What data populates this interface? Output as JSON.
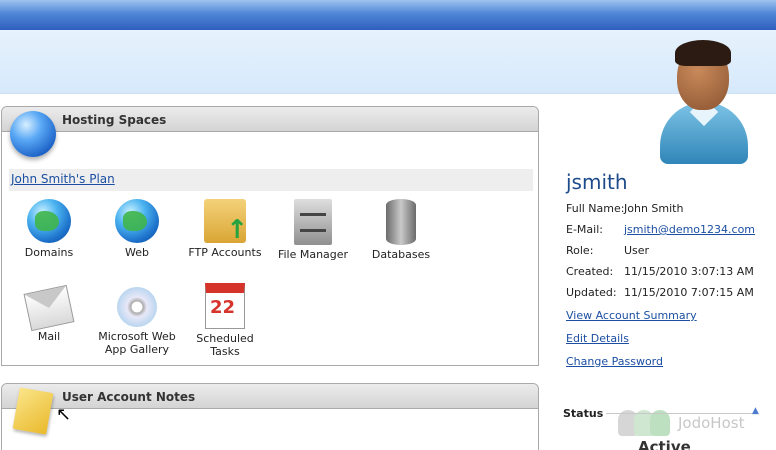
{
  "hosting": {
    "title": "Hosting Spaces",
    "plan_link": "John Smith's Plan",
    "tiles": [
      {
        "label": "Domains",
        "icon": "globe-domains-icon"
      },
      {
        "label": "Web",
        "icon": "globe-web-icon"
      },
      {
        "label": "FTP Accounts",
        "icon": "ftp-folder-icon"
      },
      {
        "label": "File Manager",
        "icon": "file-cabinet-icon"
      },
      {
        "label": "Databases",
        "icon": "database-icon"
      },
      {
        "label": "Mail",
        "icon": "mail-envelope-icon"
      },
      {
        "label": "Microsoft Web App Gallery",
        "icon": "cd-disc-icon"
      },
      {
        "label": "Scheduled Tasks",
        "icon": "calendar-clock-icon"
      }
    ]
  },
  "notes": {
    "title": "User Account Notes"
  },
  "user": {
    "username": "jsmith",
    "rows": [
      {
        "label": "Full Name:",
        "value": "John Smith"
      },
      {
        "label": "E-Mail:",
        "value": "jsmith@demo1234.com"
      },
      {
        "label": "Role:",
        "value": "User"
      },
      {
        "label": "Created:",
        "value": "11/15/2010 3:07:13 AM"
      },
      {
        "label": "Updated:",
        "value": "11/15/2010 7:07:15 AM"
      }
    ],
    "links": {
      "summary": "View Account Summary",
      "edit": "Edit Details",
      "password": "Change Password"
    }
  },
  "status": {
    "title": "Status",
    "value": "Active"
  },
  "watermark": {
    "text": "JodoHost"
  },
  "colors": {
    "link": "#1c4fa3",
    "topbar": "#2f5fbd",
    "username": "#1c4a8a"
  }
}
